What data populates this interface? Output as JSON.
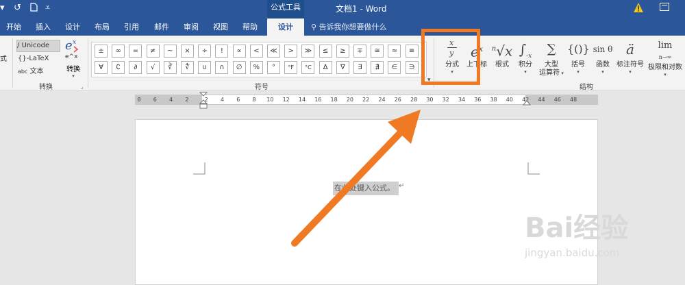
{
  "titlebar": {
    "context_tab": "公式工具",
    "doc_title": "文档1  -  Word",
    "bg": "#2b579a"
  },
  "tabs": [
    {
      "label": "开始"
    },
    {
      "label": "插入"
    },
    {
      "label": "设计"
    },
    {
      "label": "布局"
    },
    {
      "label": "引用"
    },
    {
      "label": "邮件"
    },
    {
      "label": "审阅"
    },
    {
      "label": "视图"
    },
    {
      "label": "帮助"
    },
    {
      "label": "设计",
      "active": true
    }
  ],
  "tell_me": "告诉我你想要做什么",
  "left_partial": "式",
  "conversion": {
    "unicode": "Unicode",
    "latex": "LaTeX",
    "text_prefix": "abc",
    "text": "文本",
    "convert_label": "转换",
    "group_label": "转换"
  },
  "symbols": {
    "group_label": "符号",
    "row1": [
      "±",
      "∞",
      "=",
      "≠",
      "~",
      "×",
      "÷",
      "!",
      "∝",
      "<",
      "≪",
      ">",
      "≫",
      "≤",
      "≥",
      "∓",
      "≅",
      "≈",
      "≡"
    ],
    "row2": [
      "∀",
      "∁",
      "∂",
      "√",
      "∛",
      "∜",
      "∪",
      "∩",
      "∅",
      "%",
      "°",
      "°F",
      "°C",
      "∆",
      "∇",
      "∃",
      "∄",
      "∈",
      "∋"
    ]
  },
  "structures": {
    "group_label": "结构",
    "items": [
      {
        "label": "分式"
      },
      {
        "label": "上下标"
      },
      {
        "label": "根式"
      },
      {
        "label": "积分"
      },
      {
        "label": "大型",
        "label2": "运算符"
      },
      {
        "label": "括号"
      },
      {
        "label": "函数"
      },
      {
        "label": "标注符号"
      },
      {
        "label": "极限和对数"
      }
    ]
  },
  "ruler_numbers": [
    "8",
    "6",
    "4",
    "2",
    "2",
    "4",
    "6",
    "8",
    "10",
    "12",
    "14",
    "16",
    "18",
    "20",
    "22",
    "24",
    "26",
    "28",
    "30",
    "32",
    "34",
    "36",
    "38",
    "40",
    "42",
    "44",
    "46",
    "48"
  ],
  "document": {
    "placeholder": "在此处键入公式。"
  },
  "watermark": {
    "logo": "Bai经验",
    "url": "jingyan.baidu.com"
  },
  "colors": {
    "highlight": "#f07a24",
    "ribbon": "#f3f3f3"
  }
}
